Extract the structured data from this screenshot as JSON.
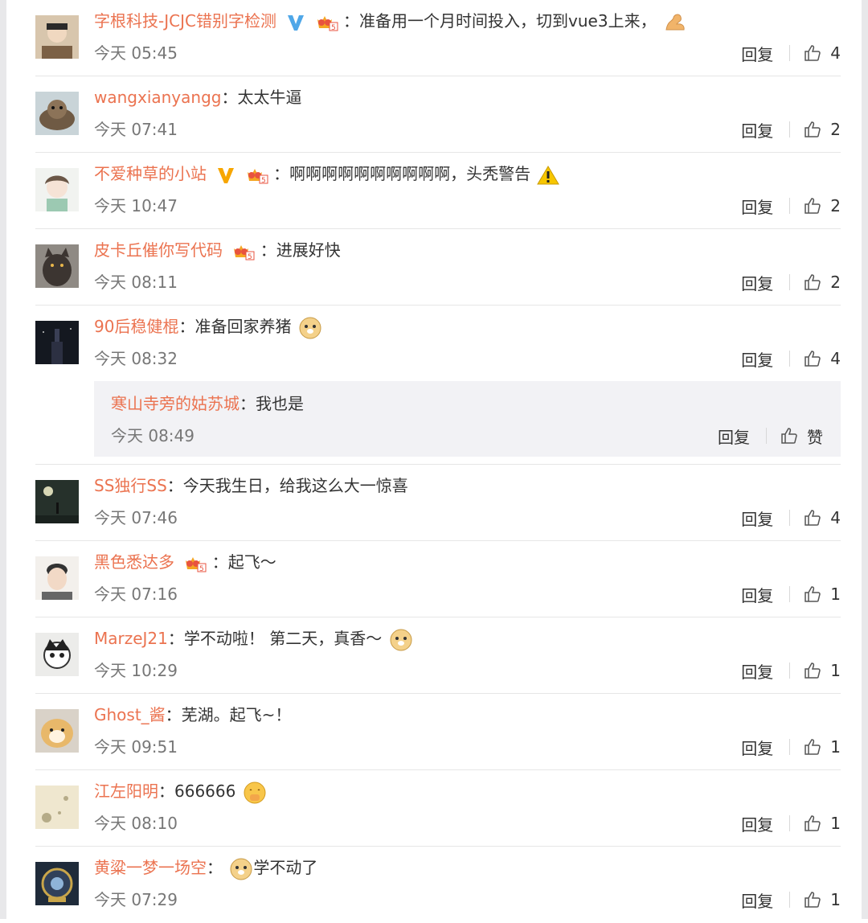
{
  "comments": [
    {
      "user": "字根科技-JCJC错别字检测",
      "verified": "blue",
      "vip": true,
      "text": "准备用一个月时间投入，切到vue3上来，",
      "emoji": "muscle-emoji",
      "time": "今天 05:45",
      "reply": "回复",
      "likes": "4"
    },
    {
      "user": "wangxianyangg",
      "verified": null,
      "vip": false,
      "text": "太太牛逼",
      "emoji": null,
      "time": "今天 07:41",
      "reply": "回复",
      "likes": "2"
    },
    {
      "user": "不爱种草的小站",
      "verified": "orange",
      "vip": true,
      "text": "啊啊啊啊啊啊啊啊啊啊，头秃警告",
      "emoji": "warning-emoji",
      "time": "今天 10:47",
      "reply": "回复",
      "likes": "2"
    },
    {
      "user": "皮卡丘催你写代码",
      "verified": null,
      "vip": true,
      "text": "进展好快",
      "emoji": null,
      "time": "今天 08:11",
      "reply": "回复",
      "likes": "2"
    },
    {
      "user": "90后稳健棍",
      "verified": null,
      "vip": false,
      "text": "准备回家养猪",
      "emoji": "doge-emoji",
      "time": "今天 08:32",
      "reply": "回复",
      "likes": "4"
    },
    {
      "user": "SS独行SS",
      "verified": null,
      "vip": false,
      "text": "今天我生日，给我这么大一惊喜",
      "emoji": null,
      "time": "今天 07:46",
      "reply": "回复",
      "likes": "4"
    },
    {
      "user": "黑色悉达多",
      "verified": null,
      "vip": true,
      "text": "起飞～",
      "emoji": null,
      "time": "今天 07:16",
      "reply": "回复",
      "likes": "1"
    },
    {
      "user": "MarzeJ21",
      "verified": null,
      "vip": false,
      "text": "学不动啦！ 第二天，真香～",
      "emoji": "doge-emoji",
      "time": "今天 10:29",
      "reply": "回复",
      "likes": "1"
    },
    {
      "user": "Ghost_酱",
      "verified": null,
      "vip": false,
      "text": "芜湖。起飞~！",
      "emoji": null,
      "time": "今天 09:51",
      "reply": "回复",
      "likes": "1"
    },
    {
      "user": "江左阳明",
      "verified": null,
      "vip": false,
      "text": "666666",
      "emoji": "shy-emoji",
      "time": "今天 08:10",
      "reply": "回复",
      "likes": "1"
    },
    {
      "user": "黄粱一梦一场空",
      "verified": null,
      "vip": false,
      "text": "学不动了",
      "emoji": "doge-emoji",
      "emoji_before_text": true,
      "time": "今天 07:29",
      "reply": "回复",
      "likes": "1"
    }
  ],
  "nested_reply": {
    "user": "寒山寺旁的姑苏城",
    "text": "我也是",
    "time": "今天 08:49",
    "reply": "回复",
    "likes": "赞"
  },
  "colors": {
    "username": "#eb7350",
    "time": "#777777",
    "verified_blue": "#4fa7e8",
    "verified_orange": "#f7a600"
  }
}
